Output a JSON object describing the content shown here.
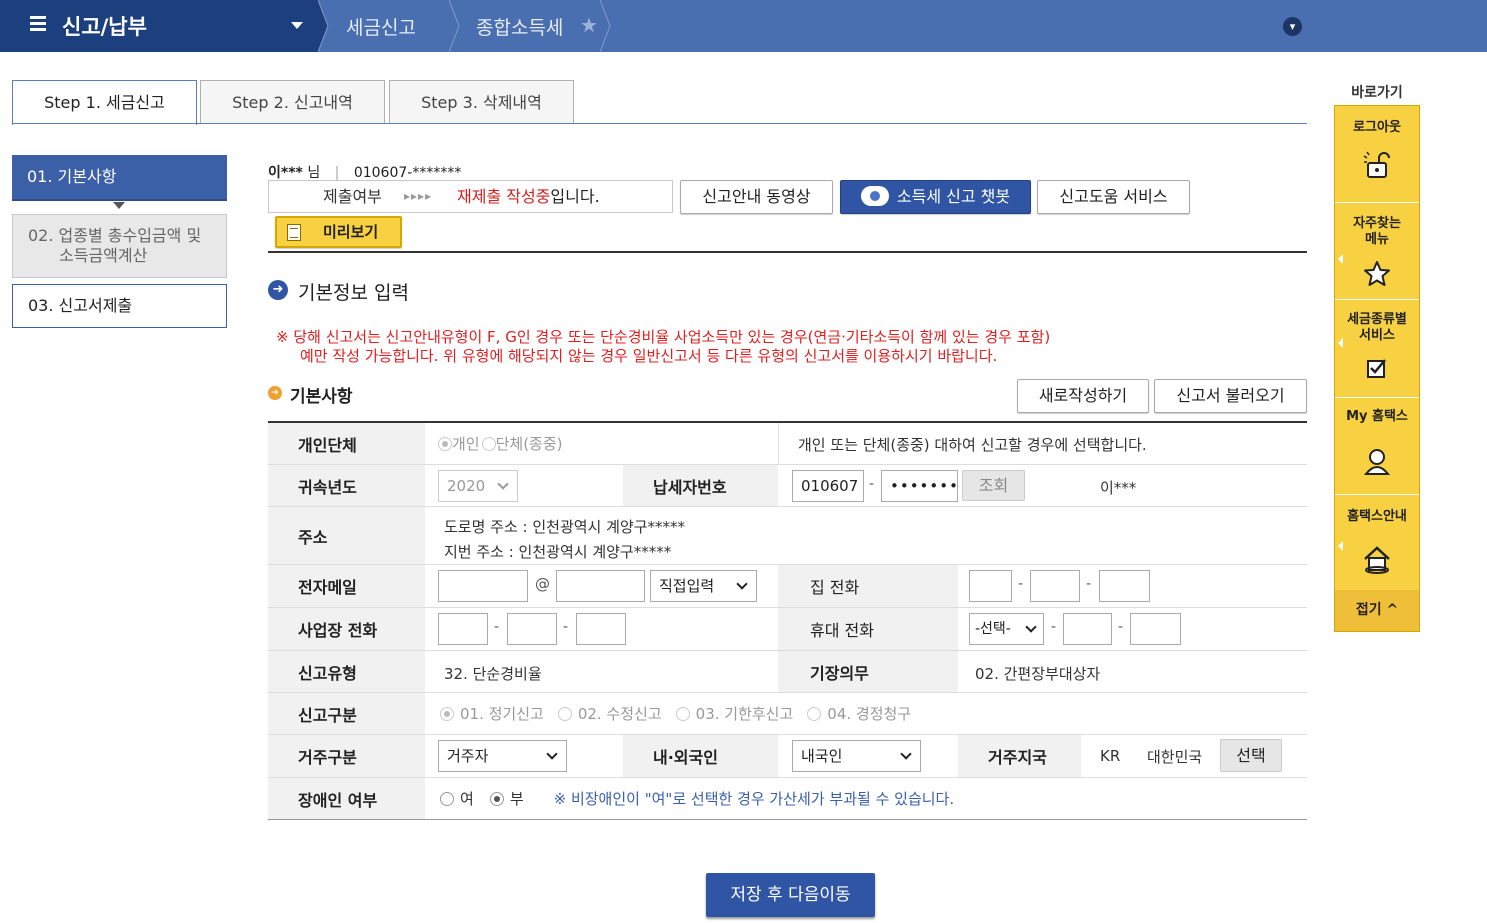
{
  "nav": {
    "menu_title": "신고/납부",
    "crumbs": [
      "세금신고",
      "종합소득세"
    ]
  },
  "steps": [
    "Step 1. 세금신고",
    "Step 2. 신고내역",
    "Step 3. 삭제내역"
  ],
  "sidebar": [
    {
      "label": "01. 기본사항"
    },
    {
      "label_line1": "02. 업종별 총수입금액 및",
      "label_line2": "소득금액계산"
    },
    {
      "label": "03. 신고서제출"
    }
  ],
  "user": {
    "name": "이***",
    "honorific": "님",
    "id": "010607-*******"
  },
  "submit_status": {
    "label": "제출여부",
    "arrows": "▸▸▸▸",
    "value_red": "재제출 작성중",
    "value_suffix": "입니다."
  },
  "buttons": {
    "guide_video": "신고안내 동영상",
    "chatbot": "소득세 신고 챗봇",
    "help_service": "신고도움 서비스",
    "preview": "미리보기",
    "new": "새로작성하기",
    "load": "신고서 불러오기",
    "inquiry": "조회",
    "region_select": "선택",
    "save_next": "저장 후 다음이동"
  },
  "section": {
    "title": "기본정보 입력",
    "notice_line1": "※ 당해 신고서는 신고안내유형이 F, G인 경우 또는 단순경비율 사업소득만 있는 경우(연금·기타소득이 함께 있는 경우 포함)",
    "notice_line2": "예만 작성 가능합니다. 위 유형에 해당되지 않는 경우 일반신고서 등 다른 유형의 신고서를 이용하시기 바랍니다.",
    "sub_title": "기본사항"
  },
  "form": {
    "individual_group": {
      "label": "개인단체",
      "opt_individual": "개인",
      "opt_group": "단체(종중)",
      "desc": "개인 또는 단체(종중) 대하여 신고할 경우에 선택합니다."
    },
    "year": {
      "label": "귀속년도",
      "value": "2020"
    },
    "taxpayer_no": {
      "label": "납세자번호",
      "front": "010607",
      "back": "•••••••",
      "name": "이***"
    },
    "address": {
      "label": "주소",
      "road": "도로명 주소 :  인천광역시 계양구*****",
      "lot": "지번 주소 :  인천광역시 계양구*****"
    },
    "email": {
      "label": "전자메일",
      "at": "@",
      "domain_select": "직접입력"
    },
    "home_phone": {
      "label": "집 전화"
    },
    "work_phone": {
      "label": "사업장 전화"
    },
    "mobile": {
      "label": "휴대 전화",
      "select": "-선택-"
    },
    "report_type": {
      "label": "신고유형",
      "value": "32. 단순경비율"
    },
    "bookkeeping": {
      "label": "기장의무",
      "value": "02. 간편장부대상자"
    },
    "report_kind": {
      "label": "신고구분",
      "options": [
        "01. 정기신고",
        "02. 수정신고",
        "03. 기한후신고",
        "04. 경정청구"
      ]
    },
    "residence": {
      "label": "거주구분",
      "value": "거주자"
    },
    "nationality": {
      "label": "내·외국인",
      "value": "내국인"
    },
    "region": {
      "label": "거주지국",
      "code": "KR",
      "name": "대한민국"
    },
    "disabled": {
      "label": "장애인 여부",
      "opt_yes": "여",
      "opt_no": "부",
      "note": "※ 비장애인이 \"여\"로 선택한 경우 가산세가 부과될 수 있습니다."
    }
  },
  "quick": {
    "title": "바로가기",
    "items": [
      {
        "label": "로그아웃",
        "icon": "logout-lock-icon"
      },
      {
        "label_line1": "자주찾는",
        "label_line2": "메뉴",
        "icon": "star-icon"
      },
      {
        "label_line1": "세금종류별",
        "label_line2": "서비스",
        "icon": "check-box-icon"
      },
      {
        "label": "My 홈택스",
        "icon": "user-icon"
      },
      {
        "label": "홈택스안내",
        "icon": "house-icon"
      }
    ],
    "fold": "접기"
  }
}
